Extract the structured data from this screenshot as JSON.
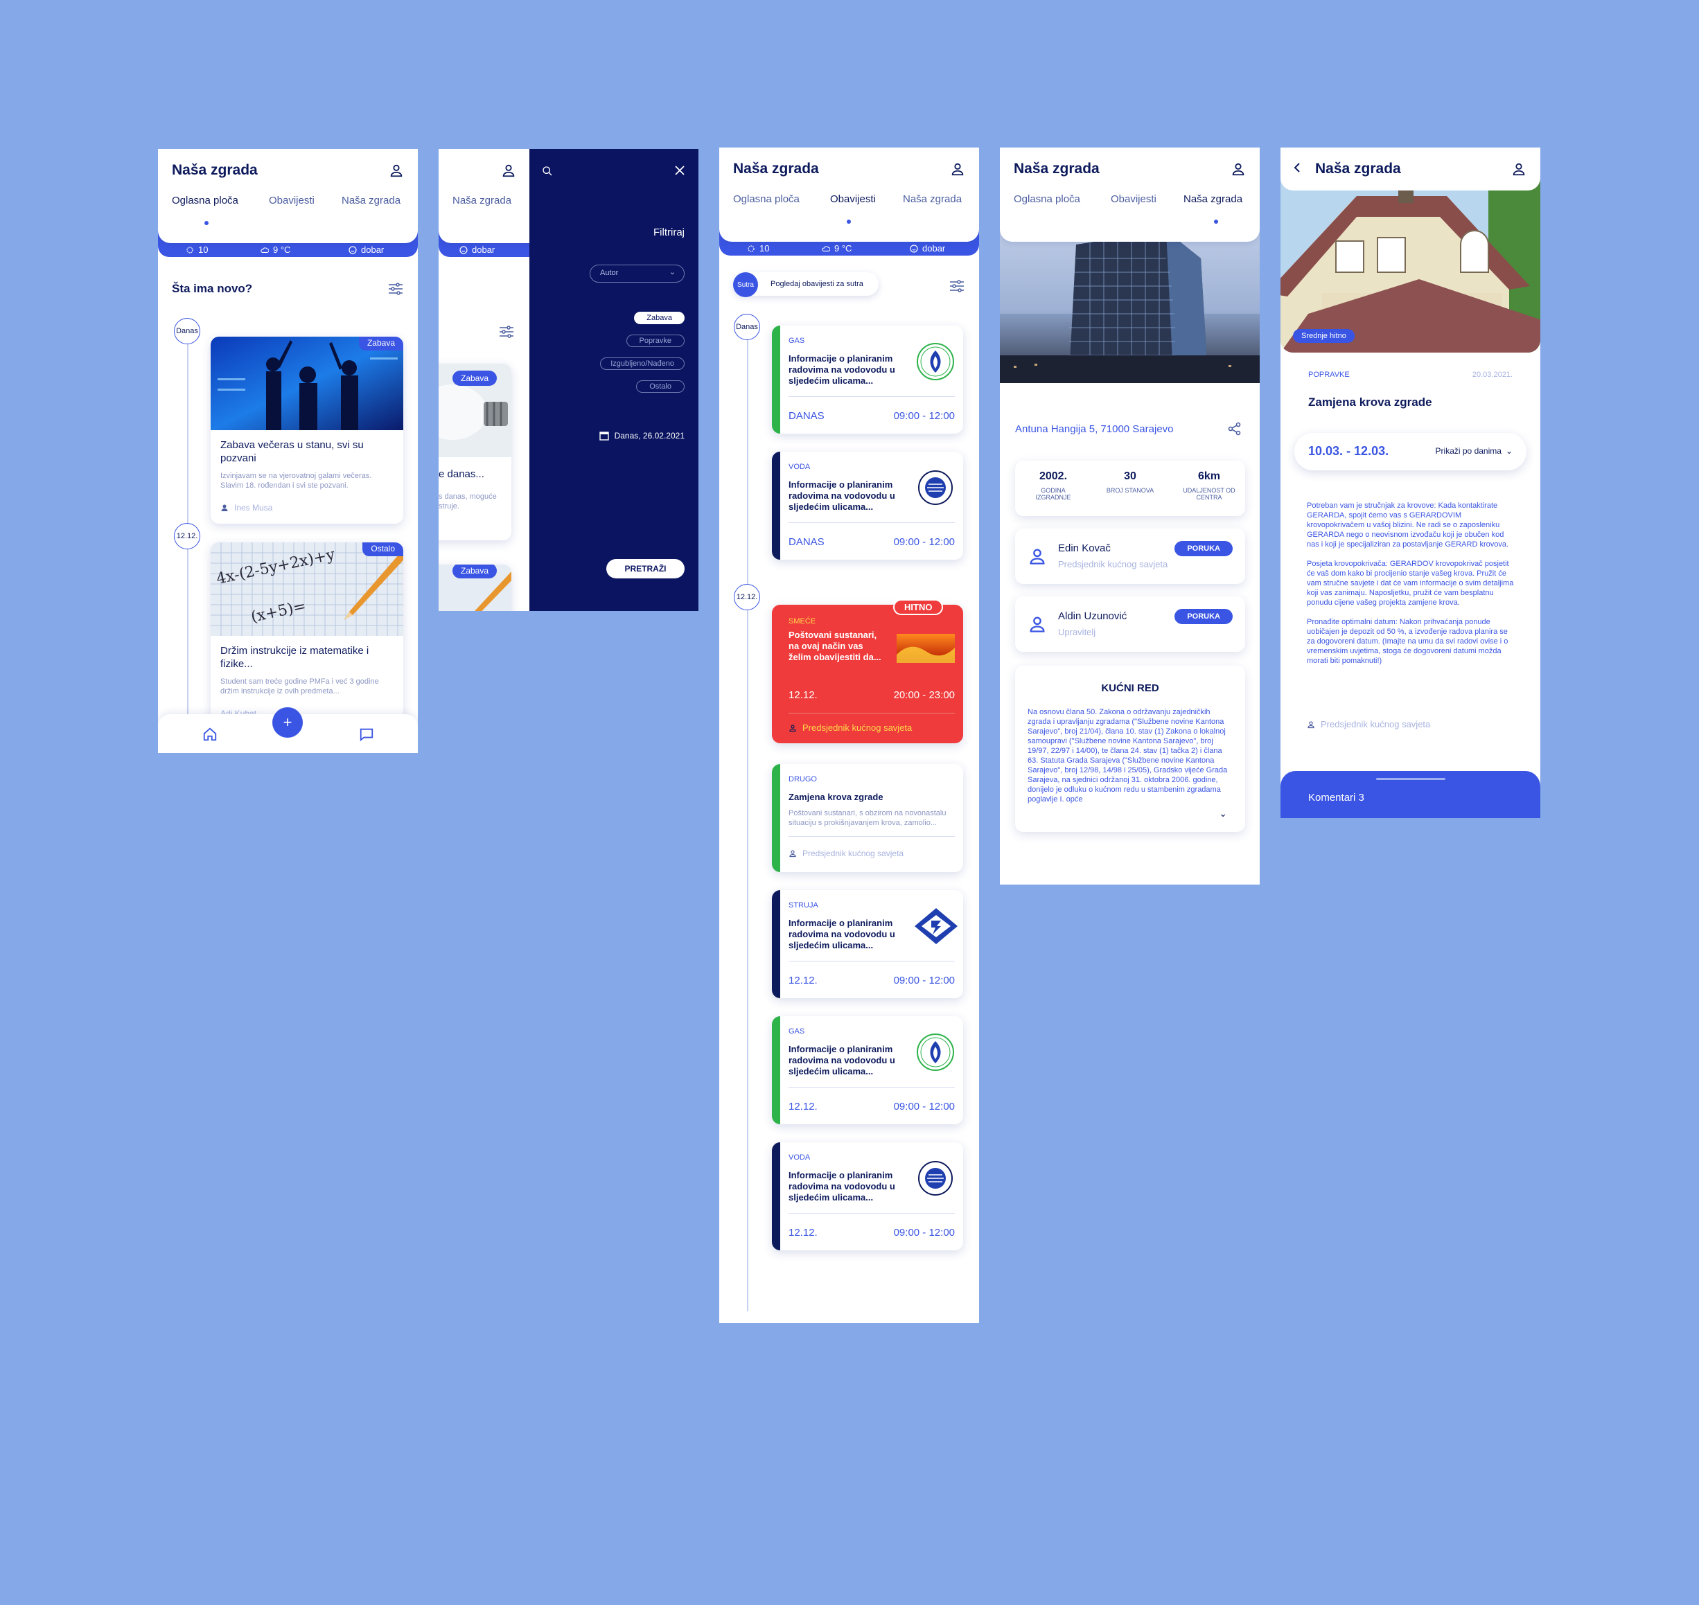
{
  "app": {
    "title": "Naša zgrada"
  },
  "tabs": {
    "board": "Oglasna ploča",
    "notices": "Obavijesti",
    "building": "Naša zgrada"
  },
  "strip": {
    "aqi": "10",
    "temp": "9 °C",
    "mood": "dobar"
  },
  "board": {
    "section_title": "Šta ima novo?",
    "badge_today": "Danas",
    "badge_date": "12.12.",
    "posts": [
      {
        "tag": "Zabava",
        "title": "Zabava večeras u stanu, svi su pozvani",
        "desc": "Izvinjavam se na vjerovatnoj galami večeras. Slavim 18. rođendan i svi ste pozvani.",
        "author": "Ines Musa"
      },
      {
        "tag": "Ostalo",
        "title": "Držim instrukcije iz matematike i fizike...",
        "desc": "Student sam treće godine PMFa i već 3 godine držim instrukcije iz ovih predmeta...",
        "author": "Adi Kubat"
      }
    ]
  },
  "filter": {
    "title": "Filtriraj",
    "author_select": "Autor",
    "chips": [
      "Zabava",
      "Popravke",
      "Izgubljeno/Nađeno",
      "Ostalo"
    ],
    "date_label": "Danas, 26.02.2021",
    "search_btn": "PRETRAŽI",
    "peek_tab": "Naša zgrada",
    "peek_mood": "dobar",
    "peek_tag1": "Zabava",
    "peek_tag2": "Zabava",
    "peek_title": "e danas...",
    "peek_desc": "s danas, moguće\nstruje."
  },
  "notices": {
    "tomorrow_badge": "Sutra",
    "tomorrow_text": "Pogledaj obavijesti za sutra",
    "badge_today": "Danas",
    "badge_date": "12.12.",
    "urgent": "HITNO",
    "items": [
      {
        "cat": "GAS",
        "title": "Informacije o planiranim radovima na vodovodu u sljedećim ulicama...",
        "date": "DANAS",
        "time": "09:00 - 12:00"
      },
      {
        "cat": "VODA",
        "title": "Informacije o planiranim radovima na vodovodu u sljedećim ulicama...",
        "date": "DANAS",
        "time": "09:00 - 12:00"
      },
      {
        "cat": "SMEĆE",
        "title": "Poštovani sustanari, na ovaj način vas želim obavijestiti da...",
        "date": "12.12.",
        "time": "20:00 - 23:00",
        "author": "Predsjednik kućnog savjeta"
      },
      {
        "cat": "DRUGO",
        "title": "Zamjena krova zgrade",
        "desc": "Poštovani sustanari, s obzirom na novonastalu situaciju s prokišnjavanjem krova, zamolio...",
        "author": "Predsjednik kućnog savjeta"
      },
      {
        "cat": "STRUJA",
        "title": "Informacije o planiranim radovima na vodovodu u sljedećim ulicama...",
        "date": "12.12.",
        "time": "09:00 - 12:00"
      },
      {
        "cat": "GAS",
        "title": "Informacije o planiranim radovima na vodovodu u sljedećim ulicama...",
        "date": "12.12.",
        "time": "09:00 - 12:00"
      },
      {
        "cat": "VODA",
        "title": "Informacije o planiranim radovima na vodovodu u sljedećim ulicama...",
        "date": "12.12.",
        "time": "09:00 - 12:00"
      }
    ]
  },
  "building": {
    "address": "Antuna Hangija 5, 71000 Sarajevo",
    "stats": [
      {
        "value": "2002.",
        "label": "GODINA IZGRADNJE"
      },
      {
        "value": "30",
        "label": "BROJ STANOVA"
      },
      {
        "value": "6km",
        "label": "UDALJENOST OD CENTRA"
      }
    ],
    "people": [
      {
        "name": "Edin Kovač",
        "role": "Predsjednik kućnog savjeta",
        "btn": "PORUKA"
      },
      {
        "name": "Aldin Uzunović",
        "role": "Upravitelj",
        "btn": "PORUKA"
      }
    ],
    "rules_title": "KUĆNI RED",
    "rules_text": "Na osnovu člana 50. Zakona o održavanju zajedničkih zgrada i upravljanju zgradama (\"Službene novine Kantona Sarajevo\", broj 21/04), člana 10. stav (1) Zakona o lokalnoj samoupravi (\"Službene novine Kantona Sarajevo\", broj 19/97, 22/97 i 14/00), te člana 24. stav (1) tačka 2) i člana 63. Statuta Grada Sarajeva (\"Službene novine Kantona Sarajevo\", broj 12/98, 14/98 i 25/05), Gradsko vijeće Grada Sarajeva, na sjednici održanoj 31. oktobra 2006. godine, donijelo je odluku o kućnom redu u stambenim zgradama poglavlje I. opće"
  },
  "detail": {
    "priority": "Srednje hitno",
    "category": "POPRAVKE",
    "date": "20.03.2021.",
    "title": "Zamjena krova zgrade",
    "range": "10.03. - 12.03.",
    "by_days": "Prikaži po danima",
    "body1": "Potreban vam je stručnjak za krovove: Kada kontaktirate GERARDA, spojit ćemo vas s GERARDOVIM krovopokrivačem u vašoj blizini. Ne radi se o zaposleniku GERARDA nego o neovisnom izvođaču koji je obučen kod nas i koji je specijaliziran za postavljanje GERARD krovova.",
    "body2": "Posjeta krovopokrivača: GERARDOV krovopokrivač posjetit će vaš dom kako bi procijenio stanje vašeg krova. Pružit će vam stručne savjete i dat će vam informacije o svim detaljima koji vas zanimaju. Naposljetku, pružit će vam besplatnu ponudu cijene vašeg projekta zamjene krova.",
    "body3": "Pronađite optimalni datum: Nakon prihvaćanja ponude uobičajen je depozit od 50 %, a izvođenje radova planira se za dogovoreni datum. (Imajte na umu da svi radovi ovise i o vremenskim uvjetima, stoga će dogovoreni datumi možda morati biti pomaknuti!)",
    "author": "Predsjednik kućnog savjeta",
    "comments": "Komentari 3"
  },
  "colors": {
    "accent": "#3a55e3",
    "navy": "#0d1a5c",
    "urgent": "#ef3b3b",
    "green": "#2db34a",
    "bg": "#85a9e8"
  },
  "icons": [
    "user-icon",
    "sun-icon",
    "cloud-icon",
    "smile-icon",
    "filter-icon",
    "home-icon",
    "plus-icon",
    "chat-icon",
    "search-icon",
    "close-icon",
    "calendar-icon",
    "share-icon",
    "back-icon",
    "chevron-down-icon"
  ]
}
